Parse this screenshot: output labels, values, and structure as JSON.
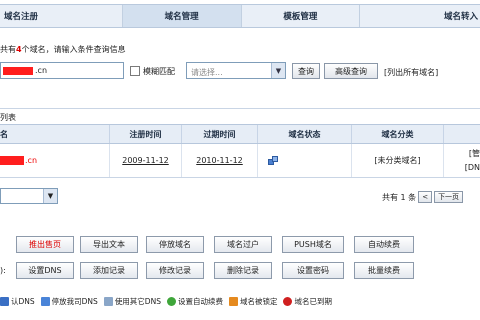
{
  "tabs": [
    {
      "label": "域名注册",
      "active": false
    },
    {
      "label": "域名管理",
      "active": true
    },
    {
      "label": "模板管理",
      "active": false
    },
    {
      "label": "域名转入",
      "active": false
    }
  ],
  "search": {
    "header_prefix": "共有",
    "header_count": "4",
    "header_suffix": "个域名，请输入条件查询信息",
    "domain_suffix": ".cn",
    "fuzzy_label": "模糊匹配",
    "select_placeholder": "请选择...",
    "query_button": "查询",
    "advanced_button": "高级查询",
    "list_all_link": "[列出所有域名]"
  },
  "list": {
    "title": "列表",
    "columns": [
      "名",
      "注册时间",
      "过期时间",
      "域名状态",
      "域名分类",
      ""
    ],
    "rows": [
      {
        "domain_suffix": ".cn",
        "register_date": "2009-11-12",
        "expire_date": "2010-11-12",
        "category": "[未分类域名]",
        "last_line1": "[管",
        "last_line2": "[DN"
      }
    ]
  },
  "pager": {
    "text": "共有 1 条",
    "prev": "<",
    "next": "下一页"
  },
  "actions": {
    "row1": [
      "推出售页",
      "导出文本",
      "停放域名",
      "域名过户",
      "PUSH域名",
      "自动续费"
    ],
    "row2_label": "):",
    "row2": [
      "设置DNS",
      "添加记录",
      "修改记录",
      "删除记录",
      "设置密码",
      "批量续费"
    ]
  },
  "legend": [
    {
      "label": "认DNS",
      "icon": "dns-icon",
      "color": "#3a6fc4"
    },
    {
      "label": "停放我司DNS",
      "icon": "park-icon",
      "color": "#4a84d8"
    },
    {
      "label": "使用其它DNS",
      "icon": "other-dns-icon",
      "color": "#8aa6c8"
    },
    {
      "label": "设置自动续费",
      "icon": "auto-renew-icon",
      "color": "#3fa63a"
    },
    {
      "label": "域名被锁定",
      "icon": "lock-icon",
      "color": "#e58a1f"
    },
    {
      "label": "域名已到期",
      "icon": "expired-icon",
      "color": "#d02020"
    }
  ]
}
